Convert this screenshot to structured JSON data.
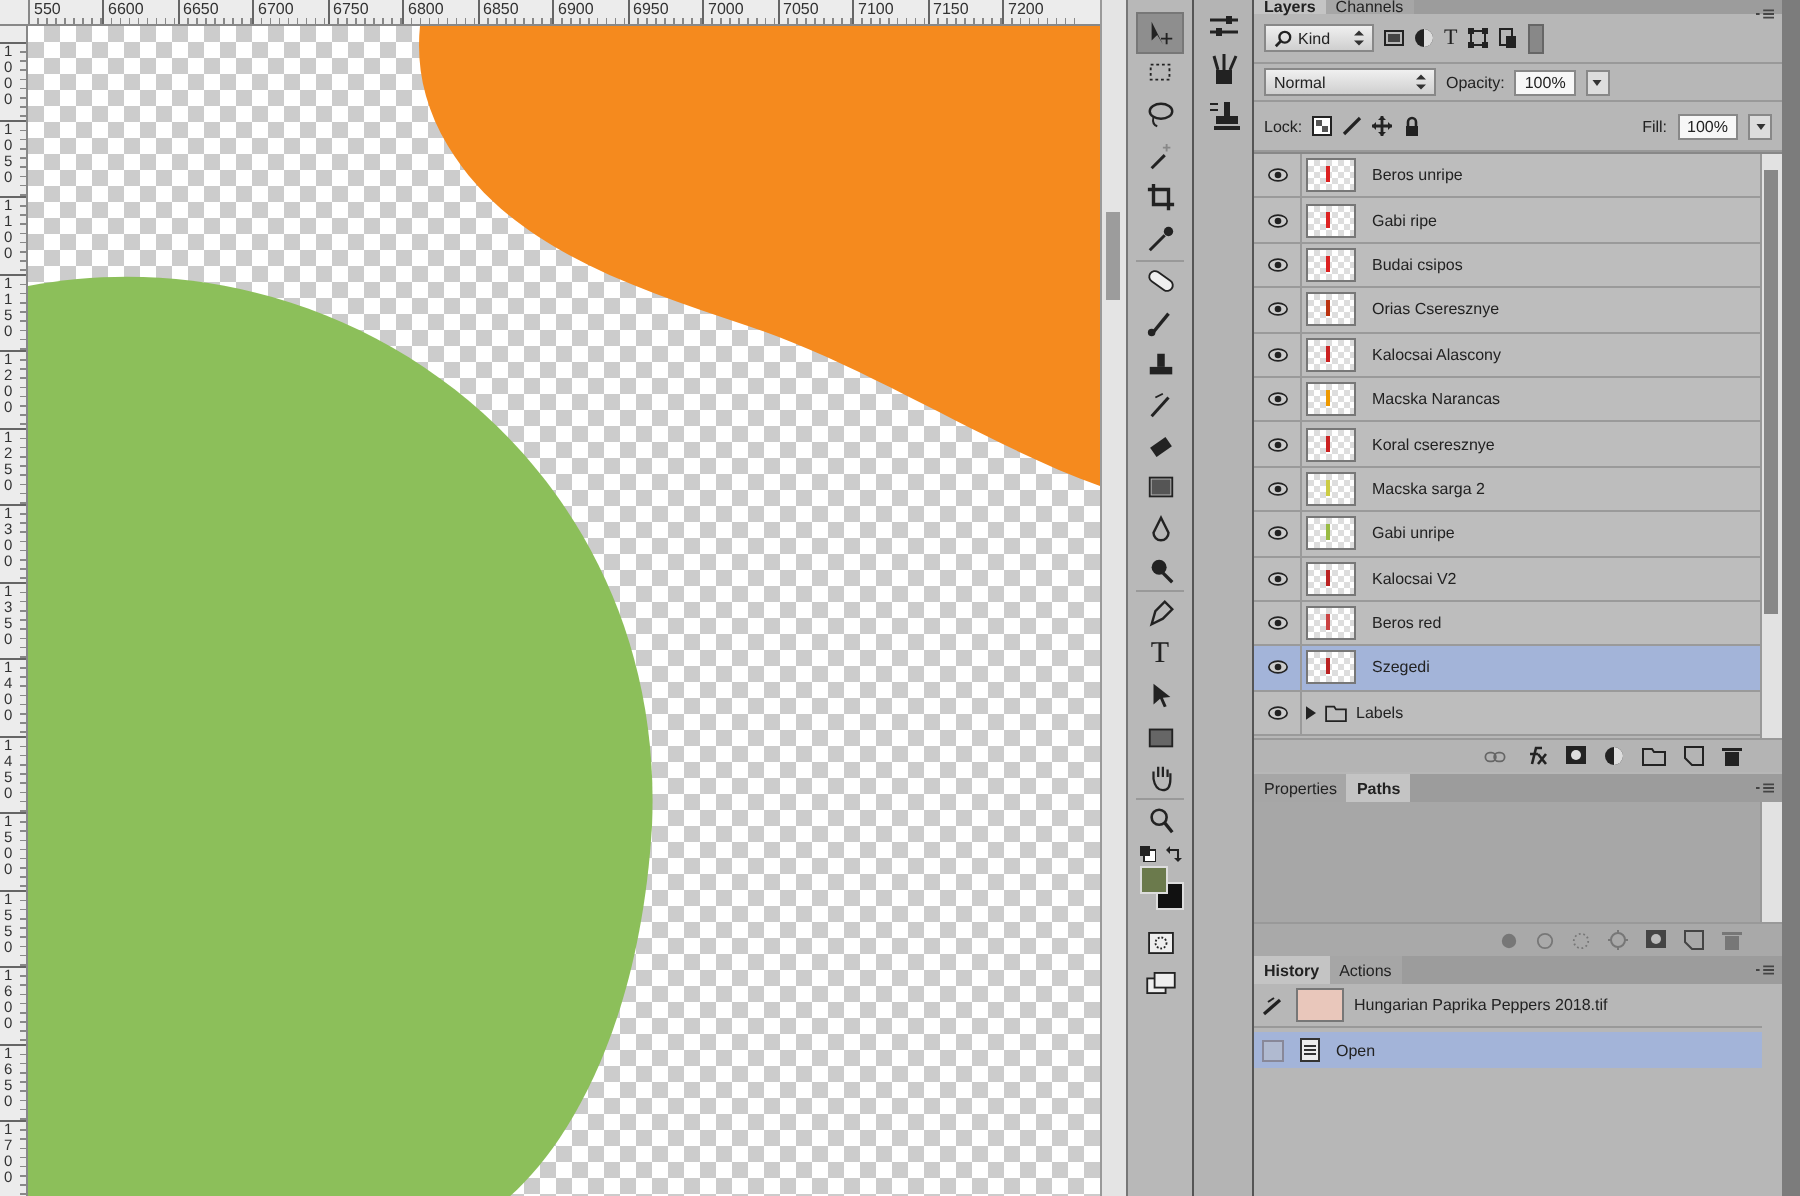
{
  "rulers": {
    "horizontal": [
      "550",
      "6600",
      "6650",
      "6700",
      "6750",
      "6800",
      "6850",
      "6900",
      "6950",
      "7000",
      "7050",
      "7100",
      "7150",
      "7200"
    ],
    "vertical": [
      "1000",
      "1050",
      "1100",
      "1150",
      "1200",
      "1250",
      "1300",
      "1350",
      "1400",
      "1450",
      "1500",
      "1550",
      "1600",
      "1650",
      "1700"
    ]
  },
  "tools": [
    {
      "kind": "move",
      "selected": true
    },
    {
      "kind": "marquee",
      "selected": false
    },
    {
      "kind": "lasso",
      "selected": false
    },
    {
      "kind": "wand",
      "selected": false
    },
    {
      "kind": "crop",
      "selected": false
    },
    {
      "kind": "eyedropper",
      "selected": false
    },
    {
      "kind": "bandage",
      "selected": false
    },
    {
      "kind": "brush",
      "selected": false
    },
    {
      "kind": "stamp",
      "selected": false
    },
    {
      "kind": "history",
      "selected": false
    },
    {
      "kind": "eraser",
      "selected": false
    },
    {
      "kind": "gradient",
      "selected": false
    },
    {
      "kind": "drop",
      "selected": false
    },
    {
      "kind": "dodge",
      "selected": false
    },
    {
      "kind": "pen",
      "selected": false
    },
    {
      "kind": "type",
      "selected": false,
      "glyph": "T"
    },
    {
      "kind": "pointer",
      "selected": false
    },
    {
      "kind": "rectangle",
      "selected": false
    },
    {
      "kind": "hand",
      "selected": false
    },
    {
      "kind": "zoom",
      "selected": false
    }
  ],
  "layers_panel": {
    "tabs": [
      {
        "label": "Layers",
        "selected": true
      },
      {
        "label": "Channels",
        "selected": false
      }
    ],
    "filter": "Kind",
    "type_filter_glyph": "T",
    "blend_mode": "Normal",
    "opacity_label": "Opacity:",
    "opacity": "100%",
    "lock_label": "Lock:",
    "fill_label": "Fill:",
    "fill": "100%",
    "layers": [
      {
        "kind": "layer",
        "name": "Beros unripe",
        "visible": true,
        "selected": false
      },
      {
        "kind": "layer",
        "name": "Gabi ripe",
        "visible": true,
        "selected": false
      },
      {
        "kind": "layer",
        "name": "Budai csipos",
        "visible": true,
        "selected": false
      },
      {
        "kind": "layer",
        "name": "Orias Cseresznye",
        "visible": true,
        "selected": false
      },
      {
        "kind": "layer",
        "name": "Kalocsai Alascony",
        "visible": true,
        "selected": false
      },
      {
        "kind": "layer",
        "name": "Macska Narancas",
        "visible": true,
        "selected": false
      },
      {
        "kind": "layer",
        "name": "Koral cseresznye",
        "visible": true,
        "selected": false
      },
      {
        "kind": "layer",
        "name": "Macska sarga 2",
        "visible": true,
        "selected": false
      },
      {
        "kind": "layer",
        "name": "Gabi unripe",
        "visible": true,
        "selected": false
      },
      {
        "kind": "layer",
        "name": "Kalocsai V2",
        "visible": true,
        "selected": false
      },
      {
        "kind": "layer",
        "name": "Beros red",
        "visible": true,
        "selected": false
      },
      {
        "kind": "layer",
        "name": "Szegedi",
        "visible": true,
        "selected": true
      },
      {
        "kind": "group",
        "name": "Labels",
        "visible": true,
        "selected": false,
        "expanded": false
      }
    ]
  },
  "paths_panel": {
    "tabs": [
      {
        "label": "Properties",
        "selected": false
      },
      {
        "label": "Paths",
        "selected": true
      }
    ]
  },
  "history_panel": {
    "tabs": [
      {
        "label": "History",
        "selected": true
      },
      {
        "label": "Actions",
        "selected": false
      }
    ],
    "snapshot": "Hungarian Paprika Peppers 2018.tif",
    "states": [
      {
        "label": "Open",
        "selected": true
      }
    ]
  }
}
